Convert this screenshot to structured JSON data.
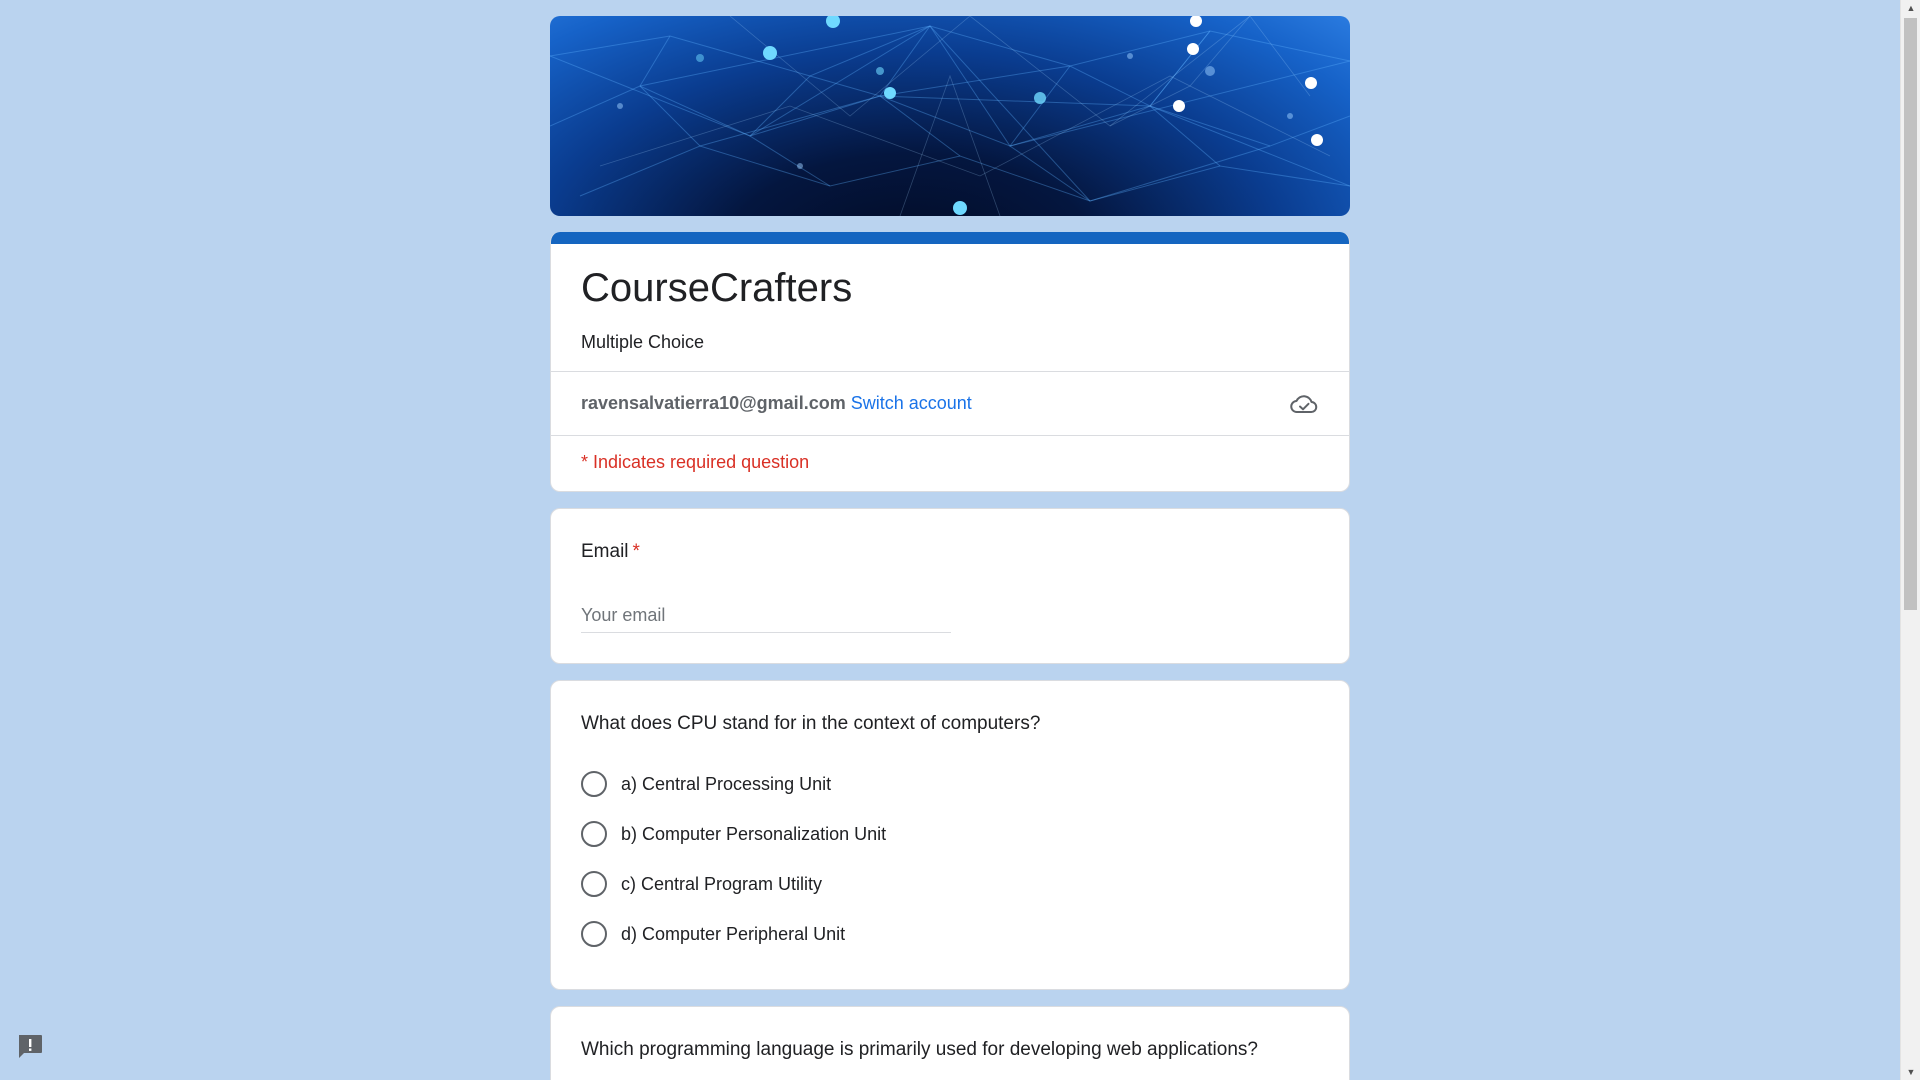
{
  "form": {
    "title": "CourseCrafters",
    "description": "Multiple Choice",
    "account_email": "ravensalvatierra10@gmail.com",
    "switch_account_label": "Switch account",
    "required_note": "* Indicates required question",
    "accent_color": "#1565c0",
    "background_color": "#bad3ef"
  },
  "questions": {
    "email": {
      "title": "Email",
      "required_mark": "*",
      "placeholder": "Your email",
      "value": ""
    },
    "q1": {
      "title": "What does CPU stand for in the context of computers?",
      "options": [
        "a) Central Processing Unit",
        "b) Computer Personalization Unit",
        "c) Central Program Utility",
        "d) Computer Peripheral Unit"
      ]
    },
    "q2": {
      "title": "Which programming language is primarily used for developing web applications?"
    }
  },
  "icons": {
    "cloud": "cloud-saved-icon",
    "report": "report-problem-icon",
    "scroll_up": "scroll-up-arrow-icon",
    "scroll_down": "scroll-down-arrow-icon"
  }
}
